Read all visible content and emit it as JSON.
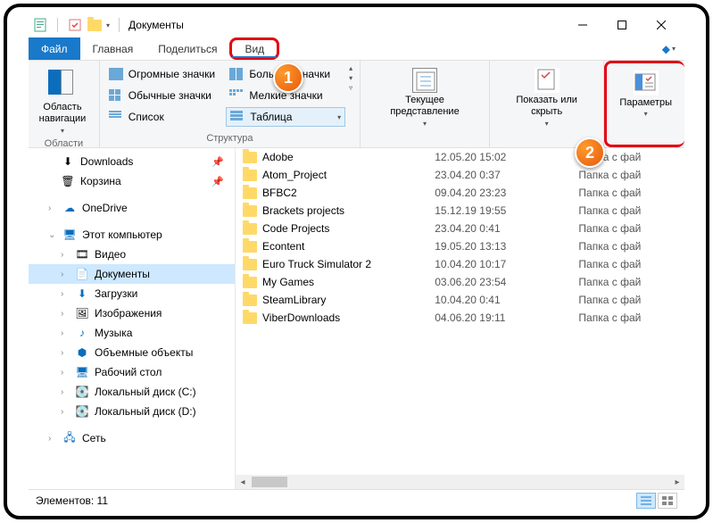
{
  "title": "Документы",
  "tabs": {
    "file": "Файл",
    "home": "Главная",
    "share": "Поделиться",
    "view": "Вид"
  },
  "ribbon": {
    "navpane": "Область навигации",
    "group_panes": "Области",
    "layouts": {
      "huge": "Огромные значки",
      "big": "Большие значки",
      "normal": "Обычные значки",
      "small": "Мелкие значки",
      "list": "Список",
      "table": "Таблица"
    },
    "group_layout": "Структура",
    "currentview": "Текущее представление",
    "showhide": "Показать или скрыть",
    "options": "Параметры"
  },
  "tree": {
    "downloads": "Downloads",
    "recycle": "Корзина",
    "onedrive": "OneDrive",
    "thispc": "Этот компьютер",
    "video": "Видео",
    "documents": "Документы",
    "downloads2": "Загрузки",
    "images": "Изображения",
    "music": "Музыка",
    "objects3d": "Объемные объекты",
    "desktop": "Рабочий стол",
    "diskc": "Локальный диск (C:)",
    "diskd": "Локальный диск (D:)",
    "network": "Сеть"
  },
  "files": [
    {
      "name": "Adobe",
      "date": "12.05.20 15:02",
      "type": "Папка с фай"
    },
    {
      "name": "Atom_Project",
      "date": "23.04.20 0:37",
      "type": "Папка с фай"
    },
    {
      "name": "BFBC2",
      "date": "09.04.20 23:23",
      "type": "Папка с фай"
    },
    {
      "name": "Brackets projects",
      "date": "15.12.19 19:55",
      "type": "Папка с фай"
    },
    {
      "name": "Code Projects",
      "date": "23.04.20 0:41",
      "type": "Папка с фай"
    },
    {
      "name": "Econtent",
      "date": "19.05.20 13:13",
      "type": "Папка с фай"
    },
    {
      "name": "Euro Truck Simulator 2",
      "date": "10.04.20 10:17",
      "type": "Папка с фай"
    },
    {
      "name": "My Games",
      "date": "03.06.20 23:54",
      "type": "Папка с фай"
    },
    {
      "name": "SteamLibrary",
      "date": "10.04.20 0:41",
      "type": "Папка с фай"
    },
    {
      "name": "ViberDownloads",
      "date": "04.06.20 19:11",
      "type": "Папка с фай"
    }
  ],
  "status": "Элементов: 11",
  "callouts": {
    "c1": "1",
    "c2": "2"
  }
}
